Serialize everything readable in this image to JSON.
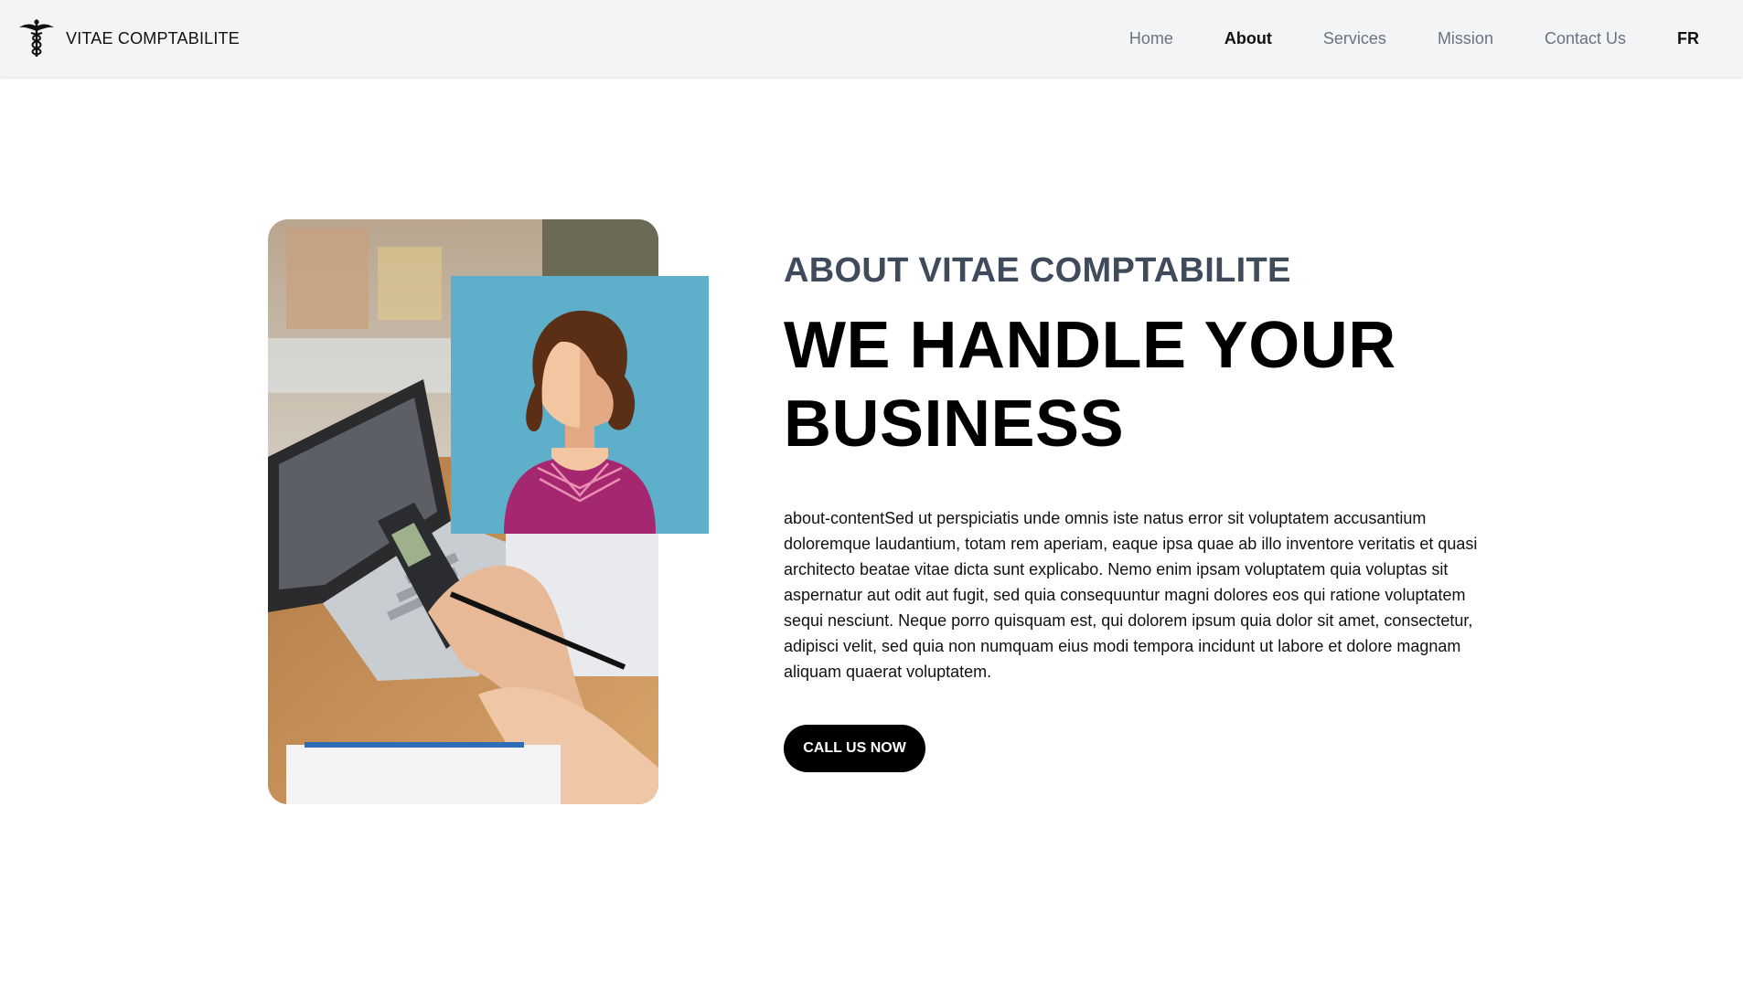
{
  "brand": {
    "name": "VITAE COMPTABILITE",
    "logo_icon": "caduceus-icon"
  },
  "nav": {
    "items": [
      {
        "label": "Home",
        "active": false
      },
      {
        "label": "About",
        "active": true
      },
      {
        "label": "Services",
        "active": false
      },
      {
        "label": "Mission",
        "active": false
      },
      {
        "label": "Contact Us",
        "active": false
      }
    ],
    "language": "FR"
  },
  "about": {
    "kicker": "ABOUT VITAE COMPTABILITE",
    "title": "WE HANDLE YOUR BUSINESS",
    "body": "about-contentSed ut perspiciatis unde omnis iste natus error sit voluptatem accusantium doloremque laudantium, totam rem aperiam, eaque ipsa quae ab illo inventore veritatis et quasi architecto beatae vitae dicta sunt explicabo. Nemo enim ipsam voluptatem quia voluptas sit aspernatur aut odit aut fugit, sed quia consequuntur magni dolores eos qui ratione voluptatem sequi nesciunt. Neque porro quisquam est, qui dolorem ipsum quia dolor sit amet, consectetur, adipisci velit, sed quia non numquam eius modi tempora incidunt ut labore et dolore magnam aliquam quaerat voluptatem.",
    "cta_label": "CALL US NOW",
    "photo": "accountant-calculator-photo",
    "avatar": "woman-avatar-illustration"
  },
  "colors": {
    "navbar_bg": "#f3f4f6",
    "avatar_bg": "#5eafca",
    "kicker": "#3f4a5a",
    "cta_bg": "#000000"
  }
}
